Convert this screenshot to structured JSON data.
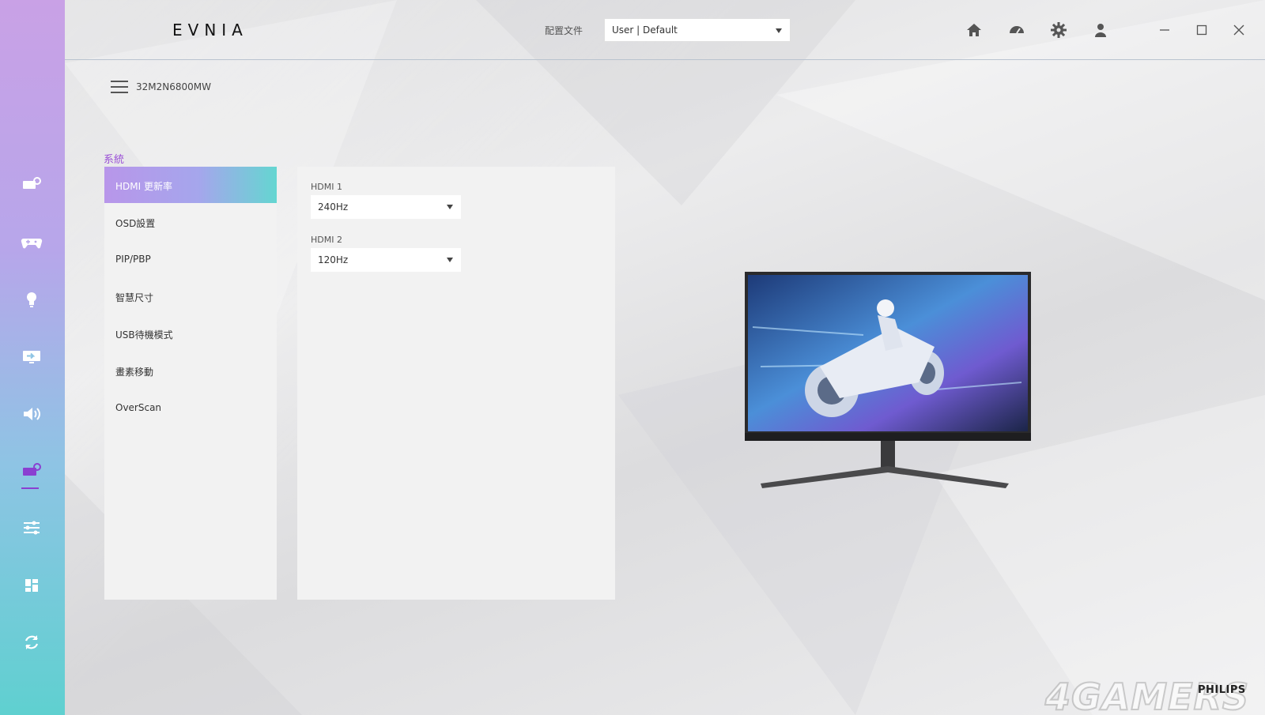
{
  "app": {
    "brand": "EVNIA",
    "profile_label": "配置文件",
    "profile_value": "User | Default"
  },
  "device": {
    "name": "32M2N6800MW"
  },
  "section": {
    "title": "系統"
  },
  "menu": {
    "items": [
      {
        "label": "HDMI 更新率",
        "active": true
      },
      {
        "label": "OSD設置"
      },
      {
        "label": "PIP/PBP"
      },
      {
        "label": "智慧尺寸"
      },
      {
        "label": "USB待機模式"
      },
      {
        "label": "畫素移動"
      },
      {
        "label": "OverScan"
      }
    ]
  },
  "settings": {
    "hdmi1": {
      "label": "HDMI 1",
      "value": "240Hz"
    },
    "hdmi2": {
      "label": "HDMI 2",
      "value": "120Hz"
    }
  },
  "rail_icons": [
    "display-settings-icon",
    "gamepad-icon",
    "light-bulb-icon",
    "input-source-icon",
    "speaker-icon",
    "system-icon",
    "sliders-icon",
    "layout-icon",
    "refresh-icon"
  ],
  "top_icons": [
    "home-icon",
    "speedometer-icon",
    "gear-icon",
    "user-icon"
  ],
  "watermark": {
    "site": "4GAMERS",
    "logo": "PHILIPS"
  },
  "colors": {
    "accent": "#9a4fd6",
    "rail_top": "#c9a1e6",
    "rail_bottom": "#5fd0d0"
  }
}
